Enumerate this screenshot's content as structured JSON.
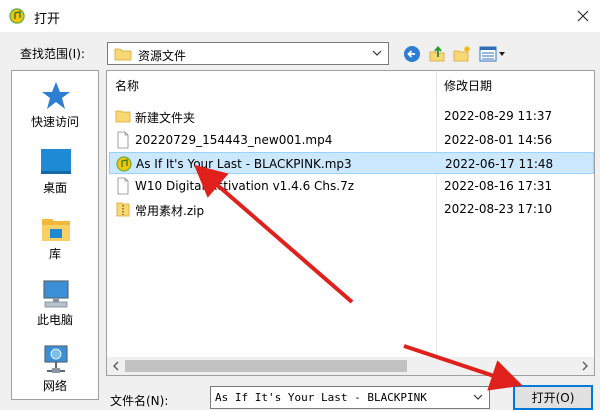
{
  "window": {
    "title": "打开"
  },
  "toolbar": {
    "lookin_label": "查找范围(I):",
    "lookin_value": "资源文件"
  },
  "places": [
    {
      "label": "快速访问",
      "icon": "star-icon"
    },
    {
      "label": "桌面",
      "icon": "desktop-icon"
    },
    {
      "label": "库",
      "icon": "library-icon"
    },
    {
      "label": "此电脑",
      "icon": "computer-icon"
    },
    {
      "label": "网络",
      "icon": "network-icon"
    }
  ],
  "filelist": {
    "columns": [
      "名称",
      "修改日期"
    ],
    "rows": [
      {
        "name": "新建文件夹",
        "date": "2022-08-29 11:37",
        "icon": "folder-icon",
        "selected": false
      },
      {
        "name": "20220729_154443_new001.mp4",
        "date": "2022-08-01 14:56",
        "icon": "file-icon",
        "selected": false
      },
      {
        "name": "As If It's Your Last - BLACKPINK.mp3",
        "date": "2022-06-17 11:48",
        "icon": "audio-file-icon",
        "selected": true
      },
      {
        "name": "W10 Digital Activation v1.4.6 Chs.7z",
        "date": "2022-08-16 17:31",
        "icon": "file-icon",
        "selected": false
      },
      {
        "name": "常用素材.zip",
        "date": "2022-08-23 17:10",
        "icon": "zip-file-icon",
        "selected": false
      }
    ]
  },
  "footer": {
    "filename_label": "文件名(N):",
    "filename_value": "As  If  It's  Your  Last - BLACKPINK",
    "open_label": "打开(O)"
  },
  "colors": {
    "selection": "#cce8ff",
    "selection_border": "#99d1ff",
    "accent": "#0078d7",
    "annotation_arrow": "#e0201b"
  }
}
